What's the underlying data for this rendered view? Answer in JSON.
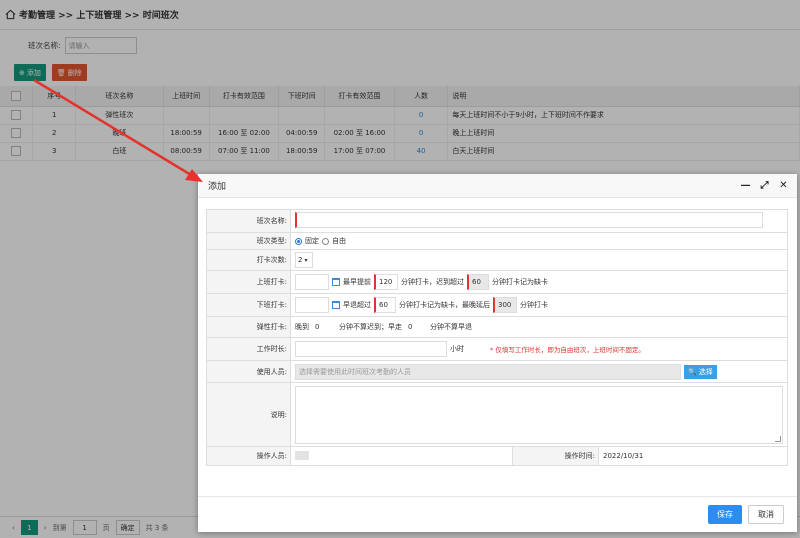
{
  "breadcrumb": "考勤管理 >> 上下班管理 >> 时间班次",
  "search": {
    "label": "班次名称:",
    "placeholder": "请输入"
  },
  "toolbar": {
    "add_label": "添加",
    "delete_label": "删除"
  },
  "table": {
    "headers": [
      "序号",
      "班次名称",
      "上班时间",
      "打卡有效范围",
      "下班时间",
      "打卡有效范围",
      "人数",
      "说明"
    ],
    "rows": [
      {
        "no": "1",
        "name": "弹性班次",
        "on": "",
        "on_range": "",
        "off": "",
        "off_range": "",
        "count": "0",
        "note": "每天上班时间不小于9小时，上下班时间不作要求"
      },
      {
        "no": "2",
        "name": "晚班",
        "on": "18:00:59",
        "on_range": "16:00 至 02:00",
        "off": "04:00:59",
        "off_range": "02:00 至 16:00",
        "count": "0",
        "note": "晚上上班时间"
      },
      {
        "no": "3",
        "name": "白班",
        "on": "08:00:59",
        "on_range": "07:00 至 11:00",
        "off": "18:00:59",
        "off_range": "17:00 至 07:00",
        "count": "40",
        "note": "白天上班时间"
      }
    ]
  },
  "pager": {
    "current": "1",
    "goto": "到第",
    "page_input": "1",
    "page_unit": "页",
    "confirm": "确定",
    "total": "共 3 条"
  },
  "dialog": {
    "title": "添加",
    "rows": {
      "name_label": "班次名称:",
      "type_label": "班次类型:",
      "type_fixed": "固定",
      "type_free": "自由",
      "punch_count_label": "打卡次数:",
      "punch_count_value": "2",
      "on_label": "上班打卡:",
      "on_earliest": "最早提前",
      "on_earliest_value": "120",
      "on_mid": "分钟打卡，迟到超过",
      "on_late_value": "60",
      "on_end": "分钟打卡记为缺卡",
      "off_label": "下班打卡:",
      "off_early": "早退超过",
      "off_early_value": "60",
      "off_mid": "分钟打卡记为缺卡，最晚延后",
      "off_late_value": "300",
      "off_end": "分钟打卡",
      "flex_label": "弹性打卡:",
      "flex_late": "晚到",
      "flex_late_value": "0",
      "flex_late_end": "分钟不算迟到；早走",
      "flex_early_value": "0",
      "flex_early_end": "分钟不算早退",
      "hours_label": "工作时长:",
      "hours_unit": "小时",
      "hours_note": "* 仅填写工作时长，即为自由班次，上班时间不固定。",
      "users_label": "使用人员:",
      "users_placeholder": "选择需要使用此时间班次考勤的人员",
      "users_select": "选择",
      "desc_label": "说明:",
      "operator_label": "操作人员:",
      "op_time_label": "操作时间:",
      "op_time_value": "2022/10/31"
    },
    "save_label": "保存",
    "cancel_label": "取消"
  },
  "colors": {
    "accent": "#169a7e",
    "danger": "#e4572e",
    "primary": "#2d8ced",
    "arrow": "#e5322d"
  }
}
